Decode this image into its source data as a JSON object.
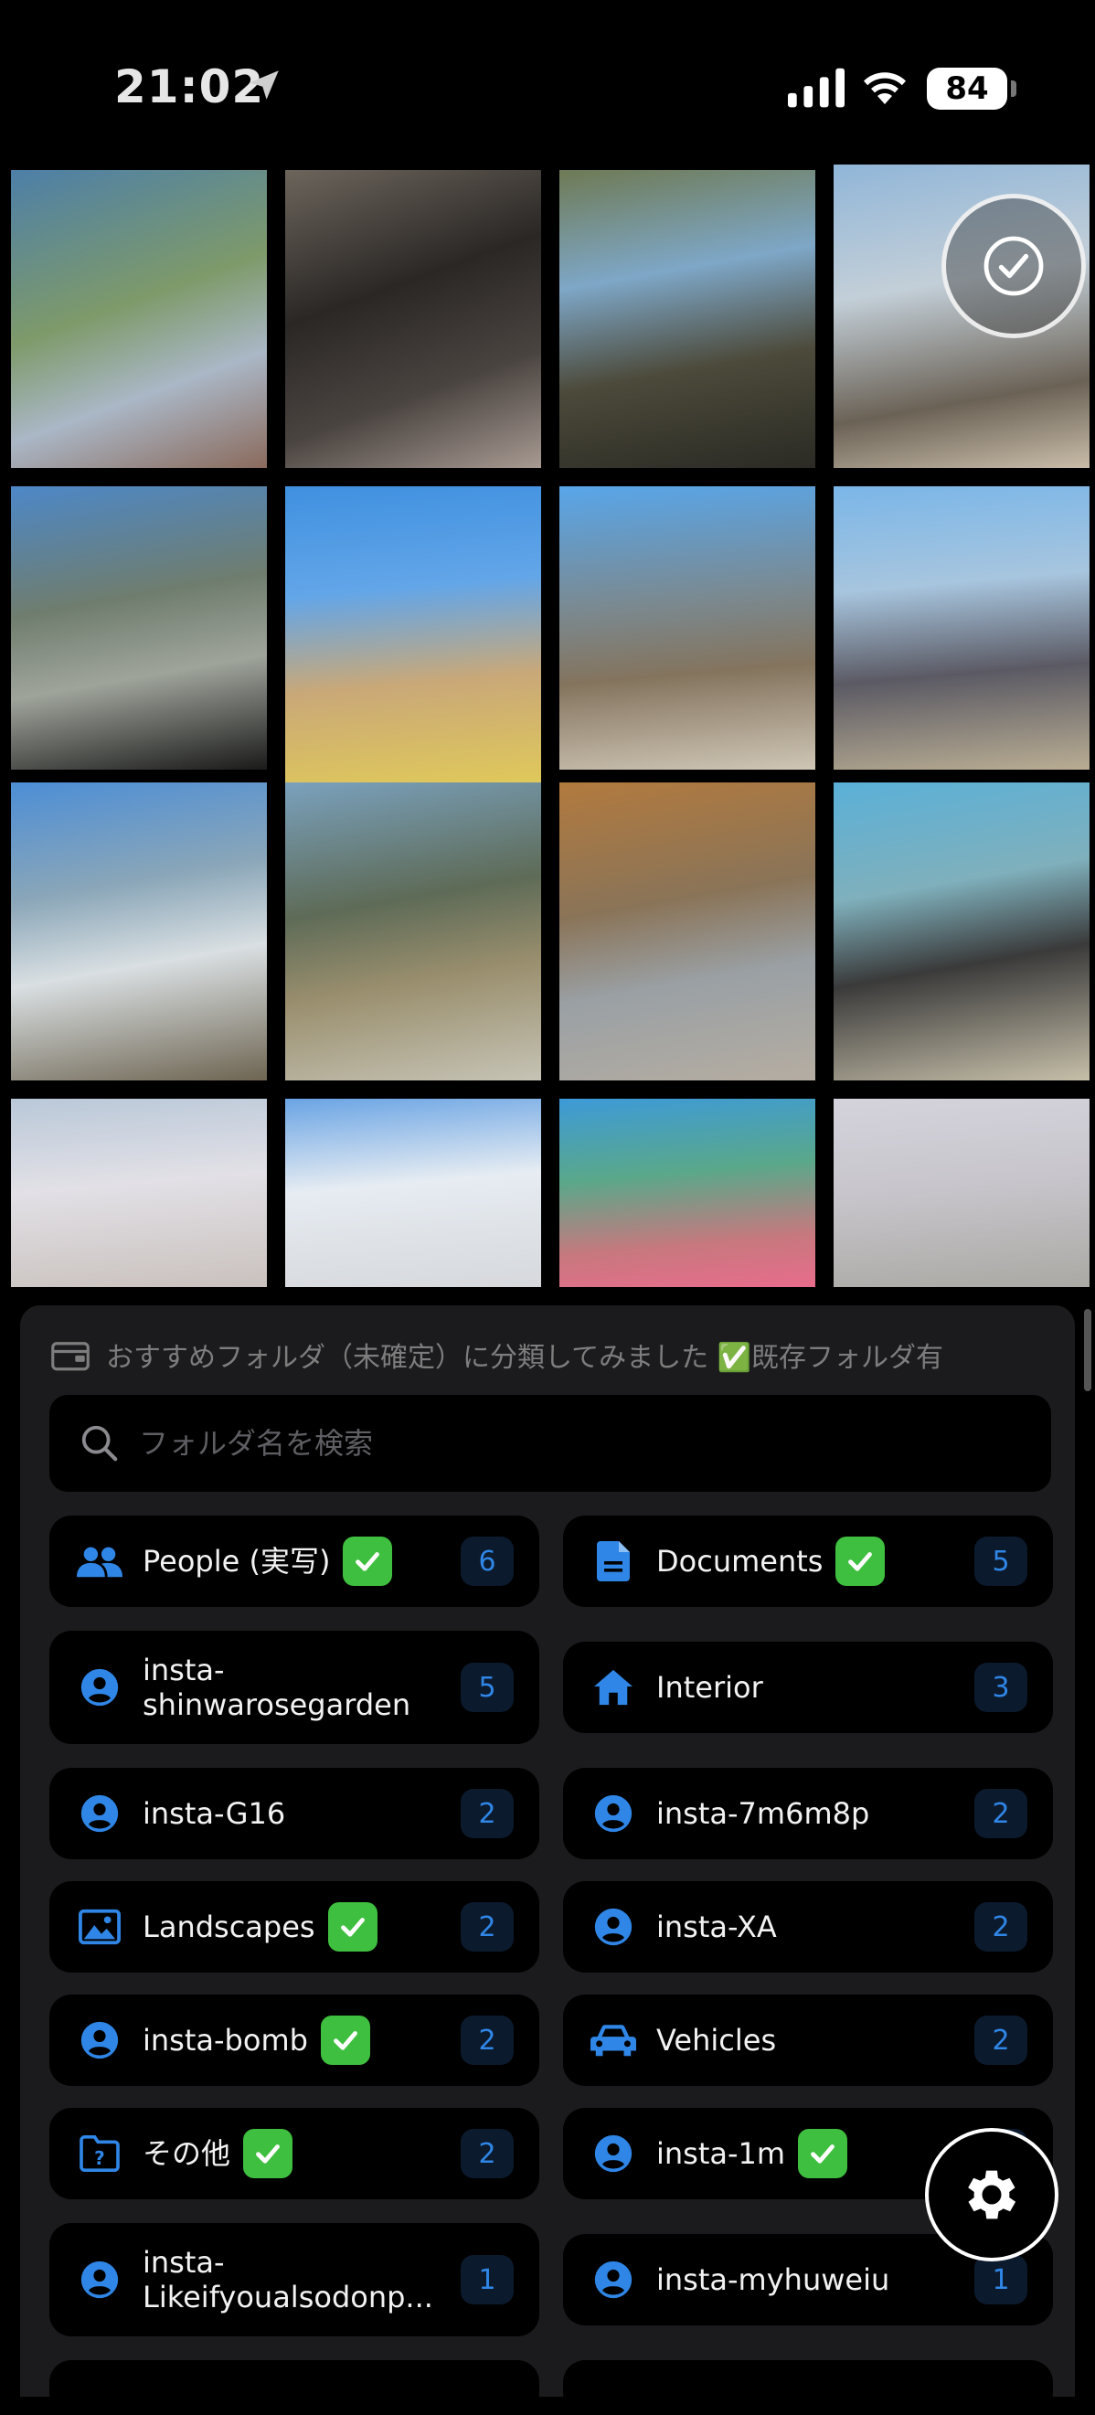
{
  "status_bar": {
    "time": "21:02",
    "battery": "84"
  },
  "sheet": {
    "banner_text": "おすすめフォルダ（未確定）に分類してみました ✅既存フォルダ有",
    "search_placeholder": "フォルダ名を検索",
    "folders": [
      {
        "name": "People (実写)",
        "checked": true,
        "count": "6",
        "icon": "people-icon"
      },
      {
        "name": "Documents",
        "checked": true,
        "count": "5",
        "icon": "document-icon"
      },
      {
        "name": "insta-shinwarosegarden",
        "line1": "insta-",
        "line2": "shinwarosegarden",
        "checked": false,
        "count": "5",
        "icon": "account-icon"
      },
      {
        "name": "Interior",
        "checked": false,
        "count": "3",
        "icon": "home-icon"
      },
      {
        "name": "insta-G16",
        "checked": false,
        "count": "2",
        "icon": "account-icon"
      },
      {
        "name": "insta-7m6m8p",
        "checked": false,
        "count": "2",
        "icon": "account-icon"
      },
      {
        "name": "Landscapes",
        "checked": true,
        "count": "2",
        "icon": "image-icon"
      },
      {
        "name": "insta-XA",
        "checked": false,
        "count": "2",
        "icon": "account-icon"
      },
      {
        "name": "insta-bomb",
        "checked": true,
        "count": "2",
        "icon": "account-icon"
      },
      {
        "name": "Vehicles",
        "checked": false,
        "count": "2",
        "icon": "car-icon"
      },
      {
        "name": "その他",
        "checked": true,
        "count": "2",
        "icon": "question-folder-icon"
      },
      {
        "name": "insta-1m",
        "checked": true,
        "count": "2",
        "icon": "account-icon"
      },
      {
        "name": "insta-Likeifyoualsodonp...",
        "line1": "insta-",
        "line2": "Likeifyoualsodonp...",
        "checked": false,
        "count": "1",
        "icon": "account-icon"
      },
      {
        "name": "insta-myhuweiu",
        "checked": false,
        "count": "1",
        "icon": "account-icon"
      }
    ]
  },
  "colors": {
    "accent": "#2f86e6",
    "check": "#3fbf3f",
    "sheet_bg": "#1b1b1d"
  }
}
